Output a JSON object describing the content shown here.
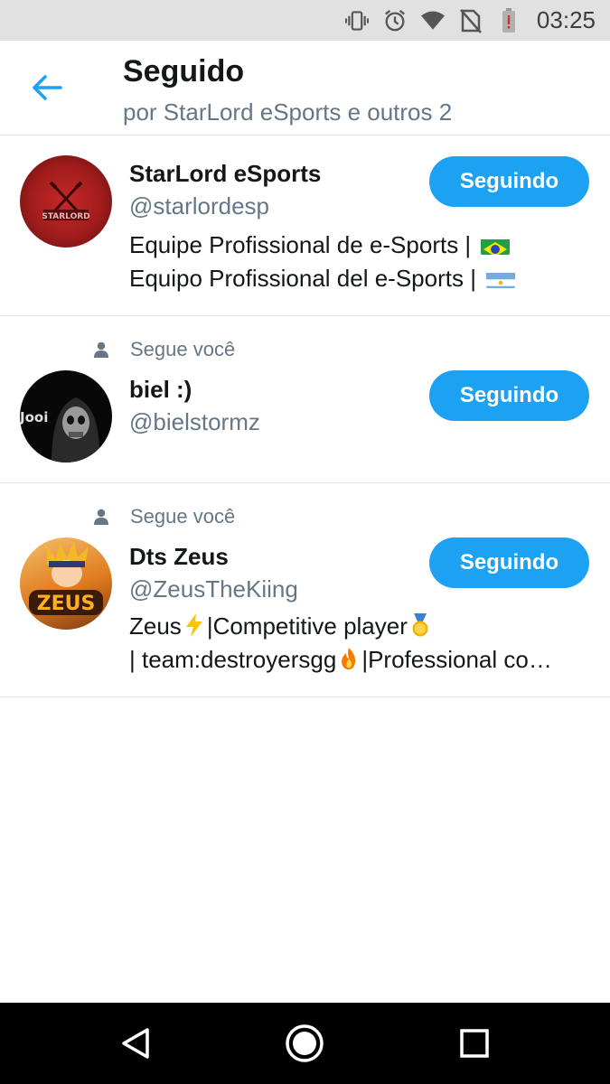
{
  "status_bar": {
    "time": "03:25",
    "icons": [
      "vibrate-icon",
      "alarm-icon",
      "wifi-icon",
      "no-sim-icon",
      "battery-low-icon"
    ]
  },
  "header": {
    "title": "Seguido",
    "subtitle": "por StarLord eSports e outros 2"
  },
  "users": [
    {
      "social_context": "",
      "name": "StarLord eSports",
      "handle": "@starlordesp",
      "bio_line1": "Equipe Profissional de e-Sports |",
      "bio_line2": "Equipo Profissional del e-Sports |",
      "button": "Seguindo",
      "avatar_logo": "STARLORD"
    },
    {
      "social_context": "Segue você",
      "name": "biel :)",
      "handle": "@bielstormz",
      "button": "Seguindo",
      "avatar_text": "Jooi"
    },
    {
      "social_context": "Segue você",
      "name": "Dts Zeus",
      "handle": "@ZeusTheKiing",
      "bio_line1_a": "Zeus",
      "bio_line1_b": "|Competitive player",
      "bio_line2_a": "| team:destroyersgg",
      "bio_line2_b": "|Professional co…",
      "button": "Seguindo",
      "avatar_logo": "ZEUS"
    }
  ],
  "nav": {
    "icons": [
      "back-triangle-icon",
      "home-circle-icon",
      "recents-square-icon"
    ]
  },
  "colors": {
    "accent": "#1da1f2",
    "secondary_text": "#657786",
    "divider": "#e1e8ed"
  }
}
